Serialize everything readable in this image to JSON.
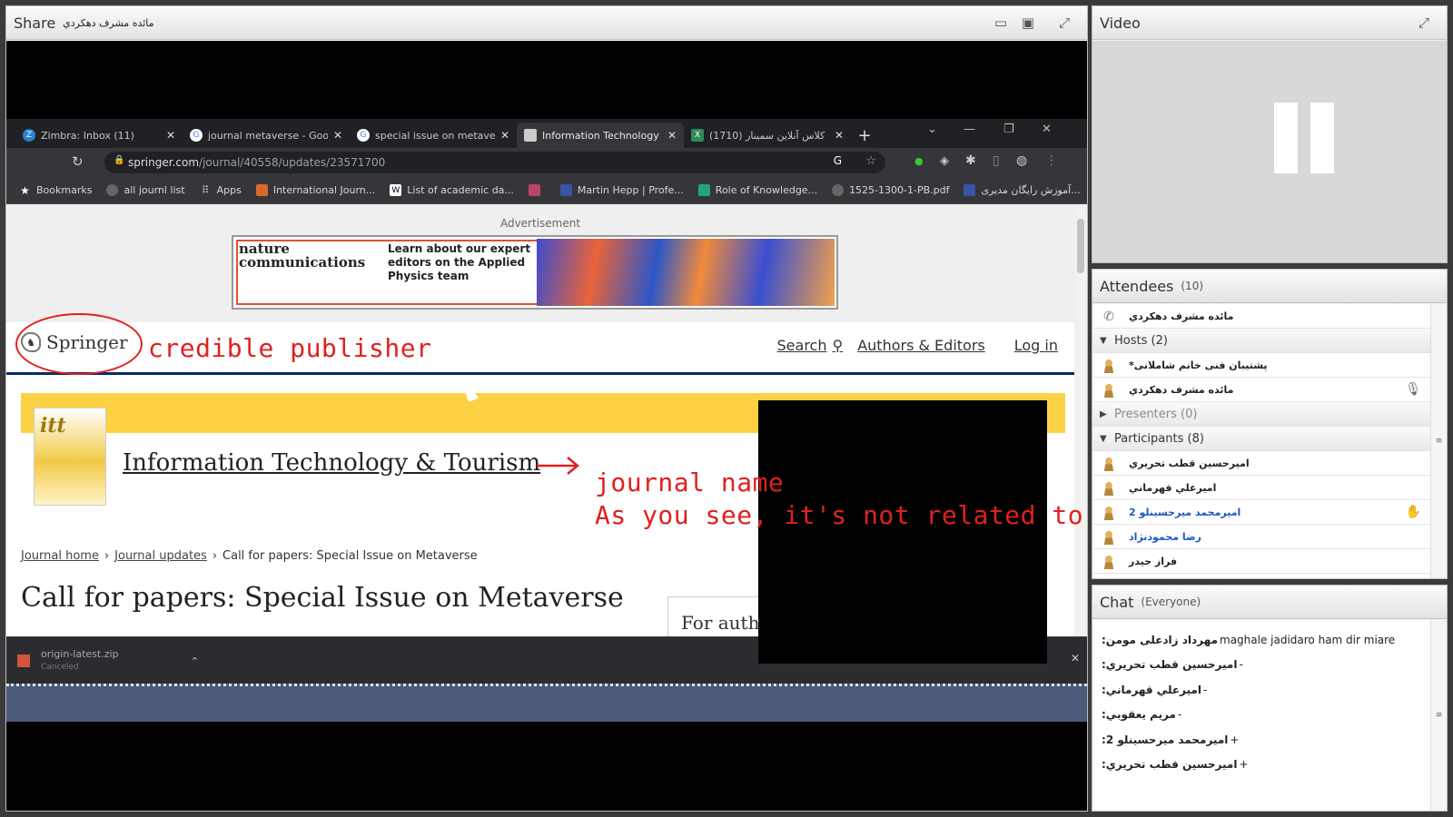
{
  "share": {
    "title": "Share",
    "presenter": "مائده مشرف دهکردي",
    "layout_icon": "layout-icon",
    "monitor_icon": "monitor-icon",
    "fullscreen_icon": "fullscreen-icon"
  },
  "browser": {
    "tabs": [
      {
        "label": "Zimbra: Inbox (11)",
        "icon": "zimbra-icon",
        "color": "#2d7fd0",
        "active": false
      },
      {
        "label": "journal metaverse - Goo",
        "icon": "google-icon",
        "color": "#ffffff",
        "active": false
      },
      {
        "label": "special issue on metaver",
        "icon": "google-icon",
        "color": "#ffffff",
        "active": false
      },
      {
        "label": "Information Technology",
        "icon": "page-icon",
        "color": "#cccccc",
        "active": true
      },
      {
        "label": "(1710) کلاس آنلاین سمینار",
        "icon": "excel-icon",
        "color": "#2e8b57",
        "active": false
      }
    ],
    "url_host": "springer.com",
    "url_path": "/journal/40558/updates/23571700",
    "bookmarks": [
      {
        "label": "Bookmarks",
        "icon": "star-icon"
      },
      {
        "label": "all journl list",
        "icon": "globe-icon"
      },
      {
        "label": "Apps",
        "icon": "apps-icon"
      },
      {
        "label": "International Journ...",
        "icon": "journal-icon"
      },
      {
        "label": "List of academic da...",
        "icon": "wikipedia-icon"
      },
      {
        "label": "",
        "icon": "pdf-icon"
      },
      {
        "label": "Martin Hepp | Profe...",
        "icon": "site-icon"
      },
      {
        "label": "Role of Knowledge...",
        "icon": "doc-icon"
      },
      {
        "label": "1525-1300-1-PB.pdf",
        "icon": "globe-icon"
      },
      {
        "label": "آموزش رایگان مدیری...",
        "icon": "site-icon"
      }
    ]
  },
  "page": {
    "ad_label": "Advertisement",
    "ad_brand_line1": "nature",
    "ad_brand_line2": "communications",
    "ad_text": "Learn about our expert editors on the Applied Physics team",
    "logo": "Springer",
    "nav": {
      "search": "Search",
      "authors": "Authors & Editors",
      "login": "Log in"
    },
    "journal_title": "Information Technology & Tourism",
    "breadcrumb": [
      "Journal home",
      "Journal updates",
      "Call for papers: Special Issue on Metaverse"
    ],
    "heading": "Call for papers: Special Issue on Metaverse",
    "side_box": "For autho",
    "download": {
      "file": "origin-latest.zip",
      "status": "Canceled"
    }
  },
  "annotations": {
    "publisher": "credible publisher",
    "journal": "journal name",
    "note": "As you see, it's not related to metaverse directly."
  },
  "video": {
    "title": "Video"
  },
  "attendees": {
    "title": "Attendees",
    "count": "(10)",
    "me": "مائده مشرف دهکردي",
    "hosts_label": "Hosts (2)",
    "hosts": [
      "پشتیبان فنی خانم شاملانی*",
      "مائده مشرف دهکردي"
    ],
    "presenters_label": "Presenters (0)",
    "participants_label": "Participants (8)",
    "participants": [
      "اميرحسين قطب تحريري",
      "اميرعلي قهرماني",
      "اميرمحمد ميرحسينلو 2",
      "رضا محمودنژاد",
      "فراز حيدر"
    ]
  },
  "chat": {
    "title": "Chat",
    "scope": "(Everyone)",
    "messages": [
      {
        "name": "مهرداد زادعلی مومن:",
        "text": "maghale jadidaro ham dir miare"
      },
      {
        "name": "اميرحسين قطب تحريري:",
        "text": "-"
      },
      {
        "name": "اميرعلي قهرماني:",
        "text": "-"
      },
      {
        "name": "مريم يعقوبي:",
        "text": "-"
      },
      {
        "name": "اميرمحمد ميرحسينلو 2:",
        "text": "+"
      },
      {
        "name": "اميرحسين قطب تحريري:",
        "text": "+"
      }
    ]
  }
}
